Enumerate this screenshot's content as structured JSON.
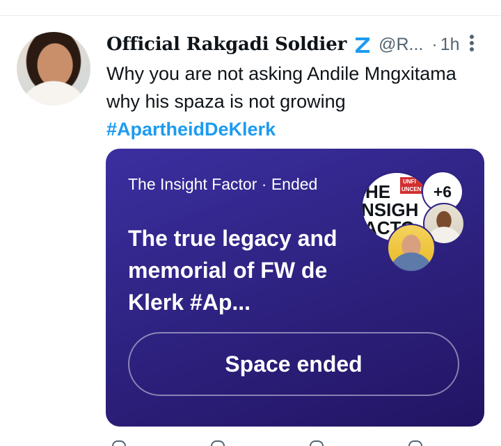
{
  "tweet": {
    "display_name": "Official Rakgadi Soldier",
    "handle": "@R...",
    "separator": "·",
    "time": "1h",
    "text": "Why you are not asking Andile Mngxitama why his spaza is not growing",
    "hashtag": "#ApartheidDeKlerk"
  },
  "space_card": {
    "host_name": "The Insight Factor",
    "separator": "·",
    "status": "Ended",
    "title": "The true legacy and memorial of FW de Klerk #Ap...",
    "extra_participants": "+6",
    "button_label": "Space ended",
    "host_logo_lines": [
      "HE",
      "NSIGH",
      "ACTO"
    ],
    "host_logo_badge": [
      "UNFI",
      "UNCENS"
    ]
  },
  "icons": {
    "avatar": "profile-photo",
    "badge": "z-emoji-icon",
    "more": "more-vertical-icon",
    "actions": [
      "reply-icon",
      "retweet-icon",
      "like-icon",
      "share-icon"
    ]
  },
  "colors": {
    "hashtag": "#1d9bf0",
    "card_bg": "#2f2383",
    "secondary_text": "#536471",
    "z_badge": "#1d9bf0"
  }
}
